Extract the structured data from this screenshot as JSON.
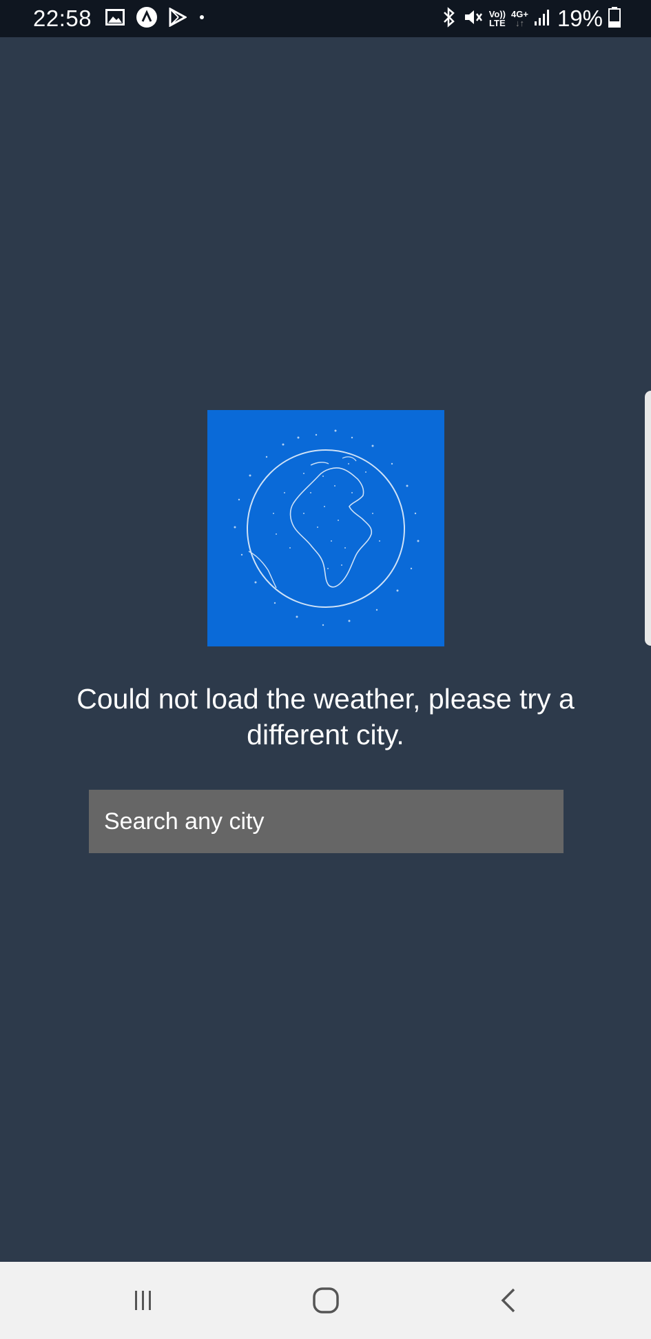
{
  "status_bar": {
    "time": "22:58",
    "battery_percent": "19%",
    "network_volte": "Vo))",
    "network_lte": "LTE",
    "network_gen": "4G+",
    "left_icons": [
      "image-icon",
      "app-icon",
      "play-store-icon",
      "dot-icon"
    ],
    "right_icons": [
      "bluetooth-icon",
      "mute-icon",
      "volte-icon",
      "4g-icon",
      "signal-icon",
      "battery-icon"
    ]
  },
  "main": {
    "globe_image": "globe-icon",
    "error_message": "Could not load the weather, please try a different city.",
    "search": {
      "placeholder": "Search any city",
      "value": ""
    }
  },
  "nav_bar": {
    "items": [
      "recent-apps-icon",
      "home-icon",
      "back-icon"
    ]
  },
  "colors": {
    "background": "#2d3a4b",
    "status_bar": "#0f1620",
    "globe_bg": "#0a6ad8",
    "search_bg": "#666666",
    "nav_bar": "#f1f1f1"
  }
}
